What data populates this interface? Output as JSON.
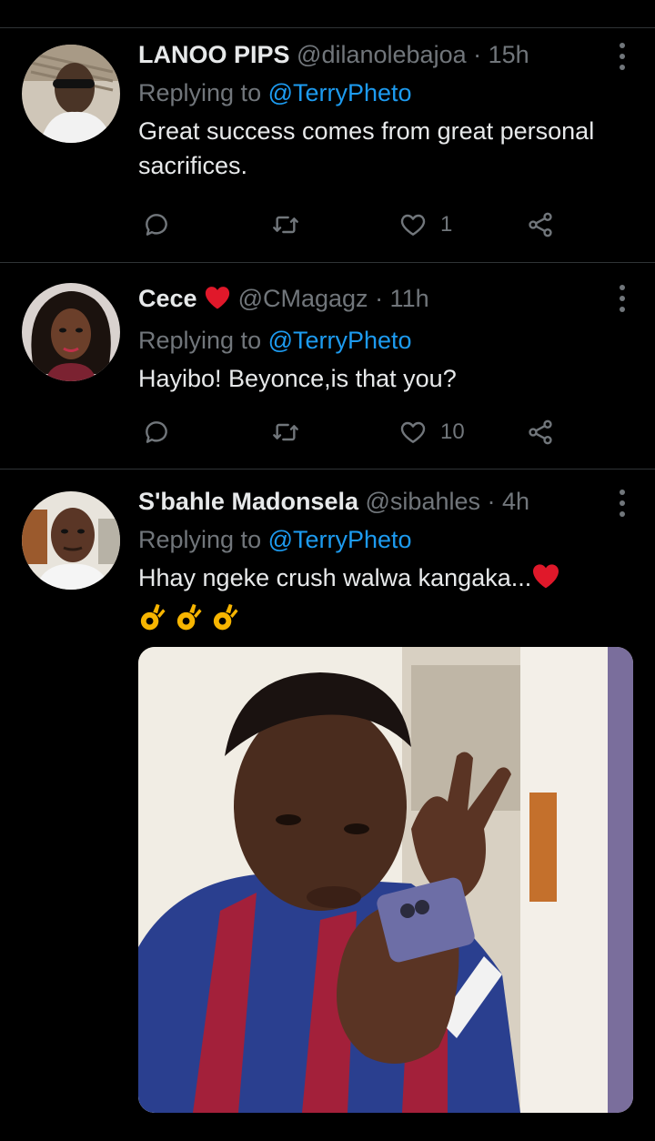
{
  "tweets": [
    {
      "name": "LANOO PIPS",
      "handle": "@dilanolebajoa",
      "time": "· 15h",
      "replying_prefix": "Replying to",
      "mention": "@TerryPheto",
      "text": "Great success comes from great personal sacrifices.",
      "likes": "1"
    },
    {
      "name": "Cece",
      "handle": "@CMagagz",
      "time": "· 11h",
      "replying_prefix": "Replying to",
      "mention": "@TerryPheto",
      "text": "Hayibo! Beyonce,is that you?",
      "likes": "10"
    },
    {
      "name": "S'bahle Madonsela",
      "handle": "@sibahles",
      "time": "· 4h",
      "replying_prefix": "Replying to",
      "mention": "@TerryPheto",
      "text": "Hhay ngeke crush walwa kangaka...",
      "emojis": [
        "ok-hand",
        "ok-hand",
        "ok-hand"
      ]
    }
  ],
  "icons": {
    "reply": "reply-icon",
    "retweet": "retweet-icon",
    "like": "heart-icon",
    "share": "share-icon",
    "more": "more-options-icon"
  },
  "colors": {
    "background": "#000000",
    "text": "#e7e9ea",
    "secondary": "#71767b",
    "accent": "#1d9bf0",
    "divider": "#2f3336",
    "heart_emoji": "#e0182a"
  }
}
